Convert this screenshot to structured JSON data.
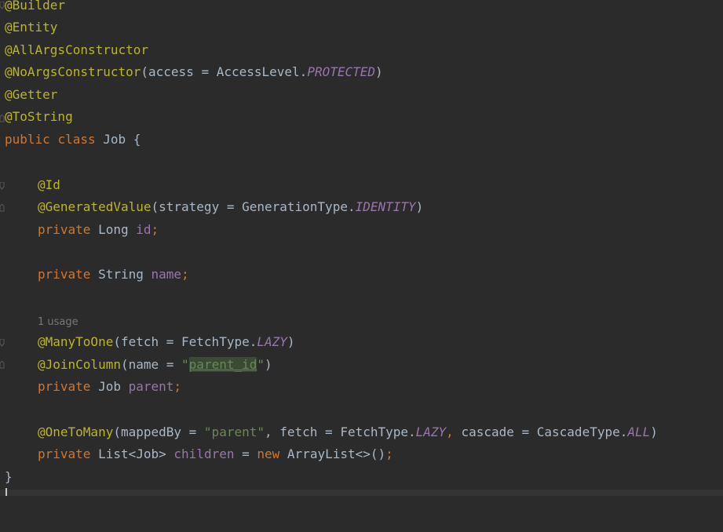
{
  "editor": {
    "lines": {
      "l1": {
        "annotation": "@Builder"
      },
      "l2": {
        "annotation": "@Entity"
      },
      "l3": {
        "annotation": "@AllArgsConstructor"
      },
      "l4": {
        "annotation": "@NoArgsConstructor",
        "open": "(access = AccessLevel.",
        "const": "PROTECTED",
        "close": ")"
      },
      "l5": {
        "annotation": "@Getter"
      },
      "l6": {
        "annotation": "@ToString"
      },
      "l7": {
        "kw1": "public",
        "kw2": "class",
        "rest": " Job {"
      },
      "l9": {
        "annotation": "@Id"
      },
      "l10": {
        "annotation": "@GeneratedValue",
        "open": "(strategy = GenerationType.",
        "const": "IDENTITY",
        "close": ")"
      },
      "l11": {
        "kw": "private",
        "type": " Long ",
        "field": "id",
        "end": ";"
      },
      "l13": {
        "kw": "private",
        "type": " String ",
        "field": "name",
        "end": ";"
      },
      "hint": "1 usage",
      "l15": {
        "annotation": "@ManyToOne",
        "open": "(fetch = FetchType.",
        "const": "LAZY",
        "close": ")"
      },
      "l16": {
        "annotation": "@JoinColumn",
        "open": "(name = ",
        "quote_open": "\"",
        "str": "parent_id",
        "quote_close": "\"",
        "close": ")"
      },
      "l17": {
        "kw": "private",
        "type": " Job ",
        "field": "parent",
        "end": ";"
      },
      "l19": {
        "annotation": "@OneToMany",
        "open": "(mappedBy = ",
        "str": "\"parent\"",
        "mid1": ", fetch = FetchType.",
        "const1": "LAZY",
        "comma": ", ",
        "mid2": "cascade = CascadeType.",
        "const2": "ALL",
        "close": ")"
      },
      "l20": {
        "kw": "private",
        "type": " List<Job> ",
        "field": "children",
        "mid": " = ",
        "kw2": "new",
        "rest": " ArrayList<>()",
        "end": ";"
      },
      "l21": {
        "brace": "}"
      }
    }
  }
}
